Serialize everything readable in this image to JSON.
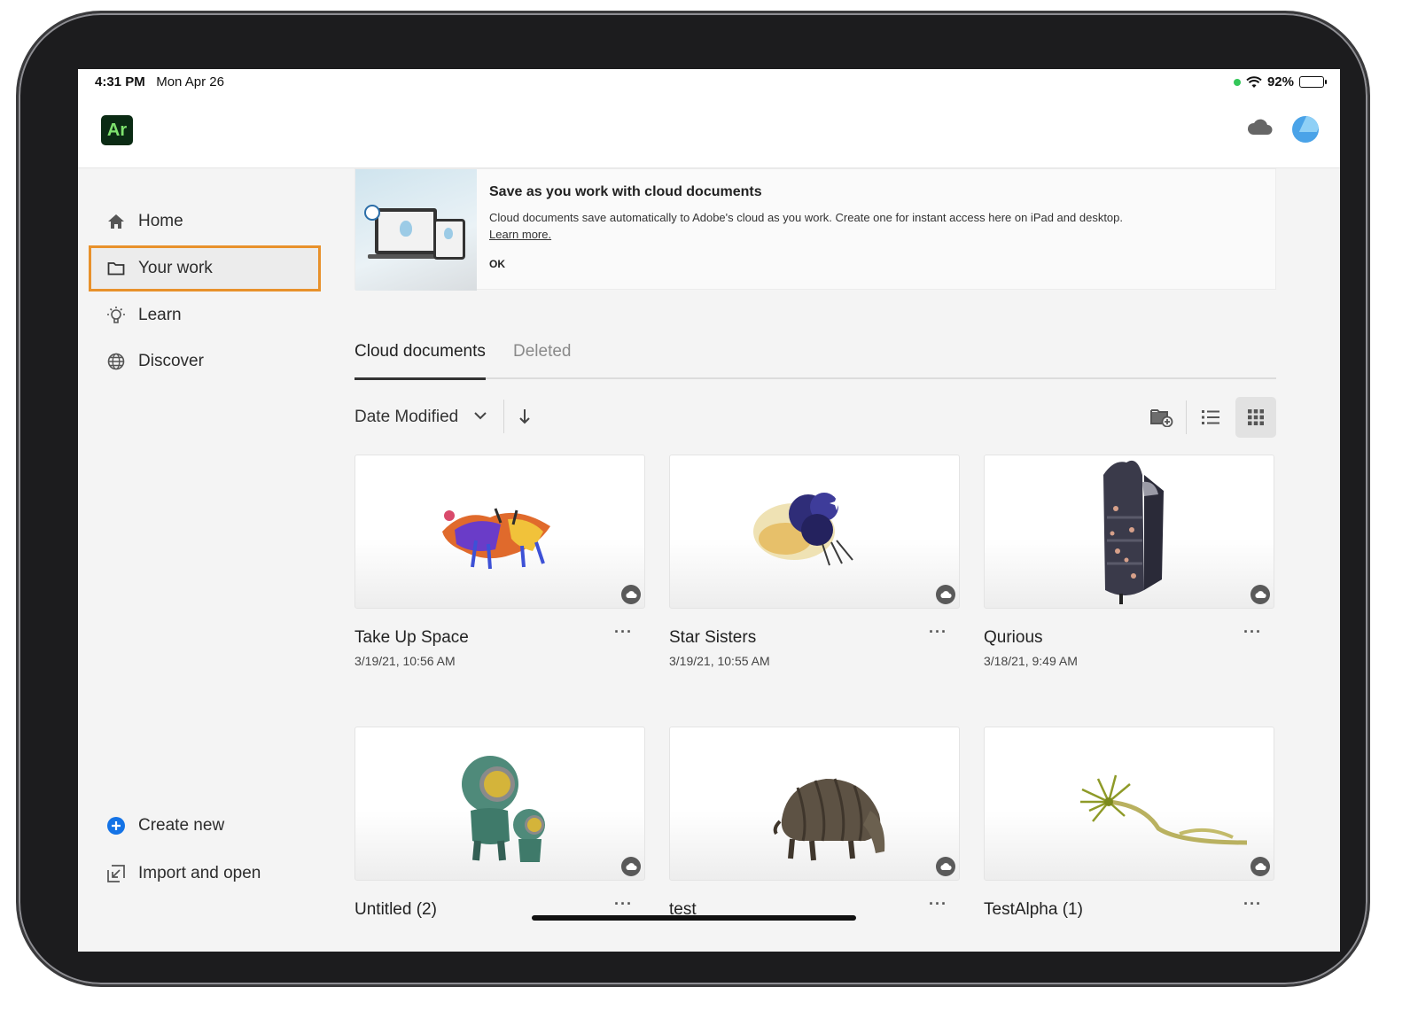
{
  "status": {
    "time": "4:31 PM",
    "date": "Mon Apr 26",
    "battery": "92%"
  },
  "app": {
    "logo": "Ar"
  },
  "sidebar": {
    "items": [
      {
        "label": "Home",
        "icon": "home-icon"
      },
      {
        "label": "Your work",
        "icon": "folder-icon",
        "active": true
      },
      {
        "label": "Learn",
        "icon": "lightbulb-icon"
      },
      {
        "label": "Discover",
        "icon": "globe-icon"
      }
    ],
    "bottom": [
      {
        "label": "Create new",
        "icon": "plus-circle-icon"
      },
      {
        "label": "Import and open",
        "icon": "import-icon"
      }
    ]
  },
  "banner": {
    "title": "Save as you work with cloud documents",
    "body": "Cloud documents save automatically to Adobe's cloud as you work. Create one for instant access here on iPad and desktop.",
    "link": "Learn more.",
    "ok": "OK"
  },
  "tabs": [
    {
      "label": "Cloud documents",
      "active": true
    },
    {
      "label": "Deleted",
      "active": false
    }
  ],
  "toolbar": {
    "sort_label": "Date Modified",
    "view": "grid"
  },
  "documents": [
    {
      "title": "Take Up Space",
      "date": "3/19/21, 10:56 AM"
    },
    {
      "title": "Star Sisters",
      "date": "3/19/21, 10:55 AM"
    },
    {
      "title": "Qurious",
      "date": "3/18/21, 9:49 AM"
    },
    {
      "title": "Untitled (2)",
      "date": ""
    },
    {
      "title": "test",
      "date": ""
    },
    {
      "title": "TestAlpha (1)",
      "date": ""
    }
  ],
  "colors": {
    "accent_outline": "#e8912b",
    "logo_bg": "#0b2b14",
    "logo_fg": "#7ee26e",
    "create_icon": "#1473e6"
  }
}
